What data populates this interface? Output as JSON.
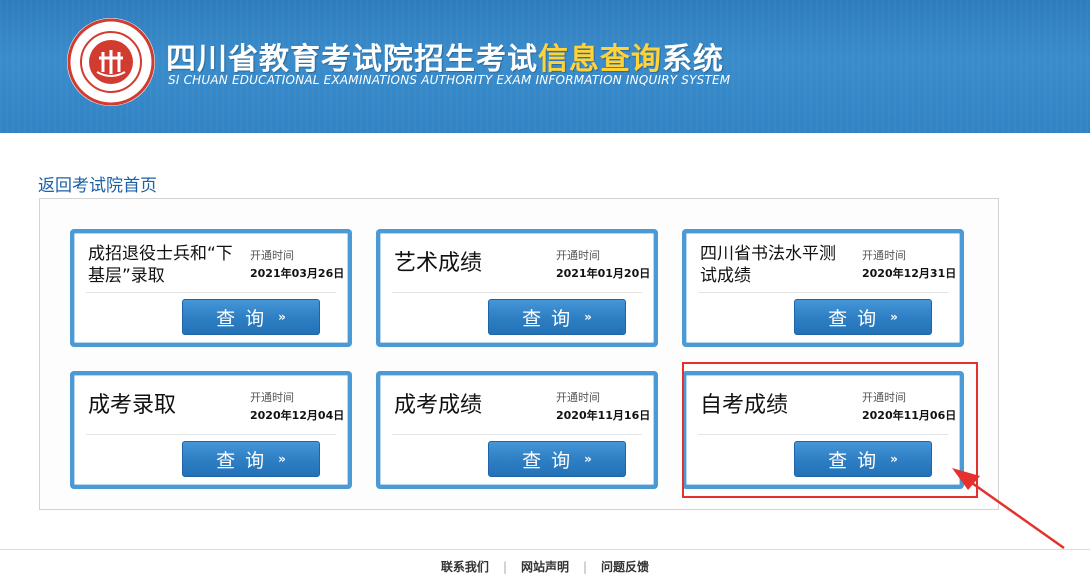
{
  "header": {
    "title_main": "四川省教育考试院招生考试",
    "title_highlight": "信息查询",
    "title_tail": "系统",
    "subtitle": "SI CHUAN EDUCATIONAL EXAMINATIONS AUTHORITY EXAM INFORMATION INQUIRY SYSTEM",
    "logo_text": "SICHUAN EDUCATIONAL EXAMINATIONS AUTHORITY 四川省教育考试院",
    "logo_icon": "seal-logo-icon"
  },
  "back_link": "返回考试院首页",
  "cards": [
    {
      "name": "成招退役士兵和“下基层”录取",
      "open_label": "开通时间",
      "open_date": "2021年03月26日",
      "button": "查询"
    },
    {
      "name": "艺术成绩",
      "open_label": "开通时间",
      "open_date": "2021年01月20日",
      "button": "查询"
    },
    {
      "name": "四川省书法水平测试成绩",
      "open_label": "开通时间",
      "open_date": "2020年12月31日",
      "button": "查询"
    },
    {
      "name": "成考录取",
      "open_label": "开通时间",
      "open_date": "2020年12月04日",
      "button": "查询"
    },
    {
      "name": "成考成绩",
      "open_label": "开通时间",
      "open_date": "2020年11月16日",
      "button": "查询"
    },
    {
      "name": "自考成绩",
      "open_label": "开通时间",
      "open_date": "2020年11月06日",
      "button": "查询"
    }
  ],
  "button_arrow": "»",
  "footer": {
    "links": [
      "联系我们",
      "网站声明",
      "问题反馈"
    ],
    "separator": "|"
  },
  "colors": {
    "header_blue": "#3283c4",
    "title_highlight": "#ffd238",
    "card_border": "#4b9ad6",
    "button_blue": "#2f7fc4",
    "annotation_red": "#e5312e"
  }
}
